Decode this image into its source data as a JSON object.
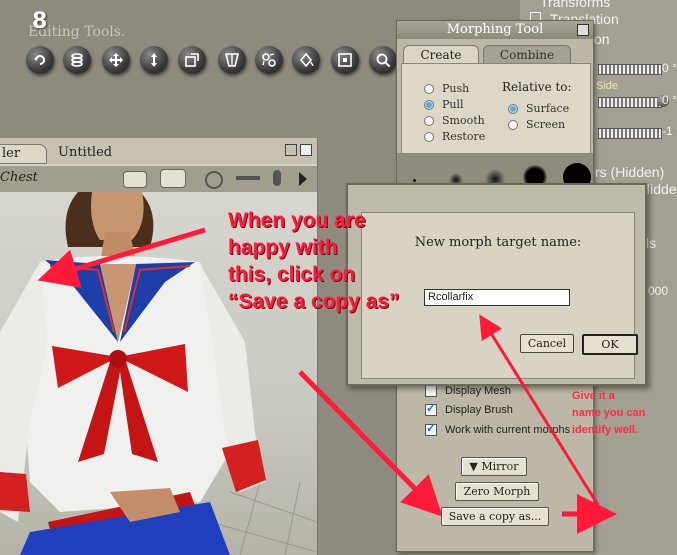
{
  "step_number": "8",
  "editing_tools_label": "Editing Tools.",
  "tools": [
    "rotate-icon",
    "twist-icon",
    "translate-icon",
    "translate-in-out-icon",
    "scale-icon",
    "taper-icon",
    "chain-break-icon",
    "color-icon",
    "view-magnifier-icon",
    "zoom-icon"
  ],
  "params_panel": {
    "transforms": "Transforms",
    "translation": "Translation",
    "on_fragment": "on",
    "side_label": "Side",
    "value_1": "0 °",
    "value_2": "0 °",
    "value_3": "-1 °",
    "hidden_1": "rs (Hidden)",
    "hidden_2": "Hidde",
    "ls_fragment": "ls",
    "num_fragment": "000"
  },
  "morph_tool": {
    "title": "Morphing Tool",
    "tab_create": "Create",
    "tab_combine": "Combine",
    "mode_options": [
      "Push",
      "Pull",
      "Smooth",
      "Restore"
    ],
    "mode_selected": "Pull",
    "relative_to_label": "Relative to:",
    "relative_options": [
      "Surface",
      "Screen"
    ],
    "relative_selected": "Surface",
    "checkbox_display_mesh": "Display Mesh",
    "checkbox_display_brush": "Display Brush",
    "checkbox_work_current": "Work with current morphs",
    "mirror_button": "▼ Mirror",
    "zero_morph_button": "Zero Morph",
    "save_copy_button": "Save a copy as..."
  },
  "document": {
    "tab_1": "ler",
    "tab_2": "Untitled",
    "selected_part": "Chest"
  },
  "dialog": {
    "label": "New morph target name:",
    "input_value": "Rcollarfix",
    "cancel": "Cancel",
    "ok": "OK"
  },
  "annotations": {
    "main_lines": [
      "When you are",
      "happy with",
      "this, click on",
      "“Save a copy as”"
    ],
    "side_lines": [
      "Give it a",
      "name you can",
      "identify well."
    ]
  },
  "colors": {
    "annotation": "#ff1a3a",
    "radio_selected": "#66aacc"
  }
}
